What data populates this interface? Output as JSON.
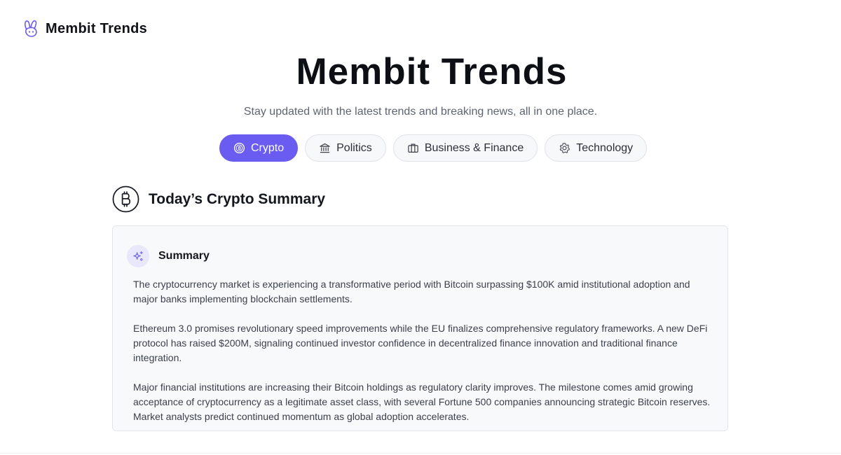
{
  "brand": {
    "name": "Membit Trends",
    "logo_icon": "rabbit-logo-icon"
  },
  "hero": {
    "title": "Membit Trends",
    "subtitle": "Stay updated with the latest trends and breaking news, all in one place."
  },
  "tabs": [
    {
      "label": "Crypto",
      "icon": "coin-icon",
      "active": true
    },
    {
      "label": "Politics",
      "icon": "bank-building-icon",
      "active": false
    },
    {
      "label": "Business & Finance",
      "icon": "briefcase-icon",
      "active": false
    },
    {
      "label": "Technology",
      "icon": "gear-icon",
      "active": false
    }
  ],
  "section": {
    "title": "Today’s Crypto Summary",
    "icon": "bitcoin-icon"
  },
  "summary": {
    "heading": "Summary",
    "icon": "sparkle-icon",
    "paragraphs": [
      "The cryptocurrency market is experiencing a transformative period with Bitcoin surpassing $100K amid institutional adoption and major banks implementing blockchain settlements.",
      "Ethereum 3.0 promises revolutionary speed improvements while the EU finalizes comprehensive regulatory frameworks. A new DeFi protocol has raised $200M, signaling continued investor confidence in decentralized finance innovation and traditional finance integration.",
      "Major financial institutions are increasing their Bitcoin holdings as regulatory clarity improves. The milestone comes amid growing acceptance of cryptocurrency as a legitimate asset class, with several Fortune 500 companies announcing strategic Bitcoin reserves. Market analysts predict continued momentum as global adoption accelerates."
    ]
  },
  "colors": {
    "accent": "#6a5cf0",
    "card_bg": "#f8f9fb",
    "text_muted": "#5f6470"
  }
}
